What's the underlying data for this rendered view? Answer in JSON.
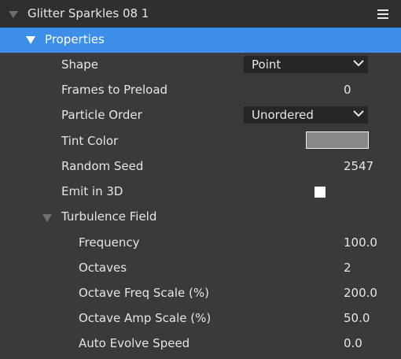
{
  "header": {
    "title": "Glitter Sparkles 08 1",
    "menu_icon": "hamburger-menu-icon"
  },
  "section": {
    "label": "Properties"
  },
  "properties": {
    "shape": {
      "label": "Shape",
      "value": "Point"
    },
    "frames_to_preload": {
      "label": "Frames to Preload",
      "value": "0"
    },
    "particle_order": {
      "label": "Particle Order",
      "value": "Unordered"
    },
    "tint_color": {
      "label": "Tint Color",
      "color": "#888888"
    },
    "random_seed": {
      "label": "Random Seed",
      "value": "2547"
    },
    "emit_in_3d": {
      "label": "Emit in 3D",
      "checked": false
    }
  },
  "turbulence": {
    "label": "Turbulence Field",
    "frequency": {
      "label": "Frequency",
      "value": "100.0"
    },
    "octaves": {
      "label": "Octaves",
      "value": "2"
    },
    "octave_freq_scale": {
      "label": "Octave Freq Scale (%)",
      "value": "200.0"
    },
    "octave_amp_scale": {
      "label": "Octave Amp Scale (%)",
      "value": "50.0"
    },
    "auto_evolve_speed": {
      "label": "Auto Evolve Speed",
      "value": "0.0"
    }
  },
  "colors": {
    "accent": "#3d8ee8",
    "background": "#3a3a3a",
    "header": "#2f2f2f"
  }
}
